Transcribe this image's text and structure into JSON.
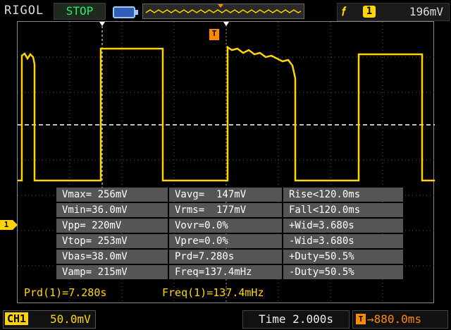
{
  "header": {
    "brand": "RIGOL",
    "run_state": "STOP",
    "trigger": {
      "edge_icon": "rising-edge-icon",
      "source": "1",
      "level": "196mV"
    }
  },
  "markers": {
    "channel1": "1",
    "trigger_pos": "T"
  },
  "measurements": [
    [
      "Vmax= 256mV",
      "Vavg=  147mV",
      "Rise<120.0ms"
    ],
    [
      "Vmin=36.0mV",
      "Vrms=  177mV",
      "Fall<120.0ms"
    ],
    [
      "Vpp= 220mV",
      "Vovr=0.0%",
      "+Wid=3.680s"
    ],
    [
      "Vtop= 253mV",
      "Vpre=0.0%",
      "-Wid=3.680s"
    ],
    [
      "Vbas=38.0mV",
      "Prd=7.280s",
      "+Duty=50.5%"
    ],
    [
      "Vamp= 215mV",
      "Freq=137.4mHz",
      "-Duty=50.5%"
    ]
  ],
  "quick_measure": {
    "period": "Prd(1)=7.280s",
    "frequency": "Freq(1)=137.4mHz"
  },
  "footer": {
    "ch1_label": "CH1",
    "ch1_scale": "50.0mV",
    "timebase": "Time 2.000s",
    "delay": "880.0ms"
  },
  "colors": {
    "channel1": "#ffd400",
    "trigger": "#ff8a00",
    "run_state": "#2ee86a",
    "grid": "#6a6a6a"
  }
}
